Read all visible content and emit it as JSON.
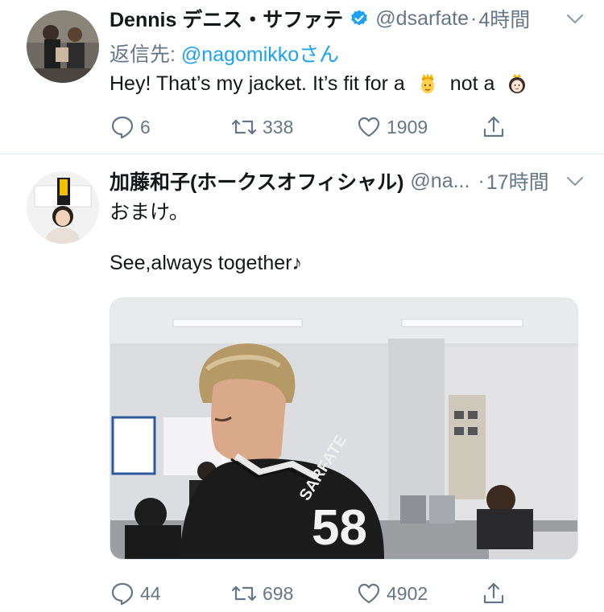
{
  "tweets": [
    {
      "display_name": "Dennis デニス・サファテ",
      "handle": "@dsarfate",
      "separator": "·",
      "time": "4時間",
      "verified": true,
      "reply_prefix": "返信先: ",
      "reply_mention": "@nagomikkoさん",
      "text_before": "Hey! That’s my jacket. It’s fit for a",
      "text_middle": "not a",
      "emoji_1": "prince-emoji",
      "emoji_2": "princess-emoji",
      "replies": "6",
      "retweets": "338",
      "likes": "1909"
    },
    {
      "display_name": "加藤和子(ホークスオフィシャル)",
      "handle": "@na...",
      "separator": "·",
      "time": "17時間",
      "verified": false,
      "text_line1": "おまけ。",
      "text_line2": "See,always together♪",
      "jersey_name": "SARFATE",
      "jersey_number": "58",
      "replies": "44",
      "retweets": "698",
      "likes": "4902"
    }
  ],
  "colors": {
    "text_primary": "#14171a",
    "text_secondary": "#657786",
    "link": "#1da1f2",
    "verified": "#1da1f2",
    "divider": "#e1e8ed"
  },
  "icons": [
    "reply-icon",
    "retweet-icon",
    "like-icon",
    "share-icon",
    "chevron-down-icon",
    "verified-badge-icon"
  ]
}
